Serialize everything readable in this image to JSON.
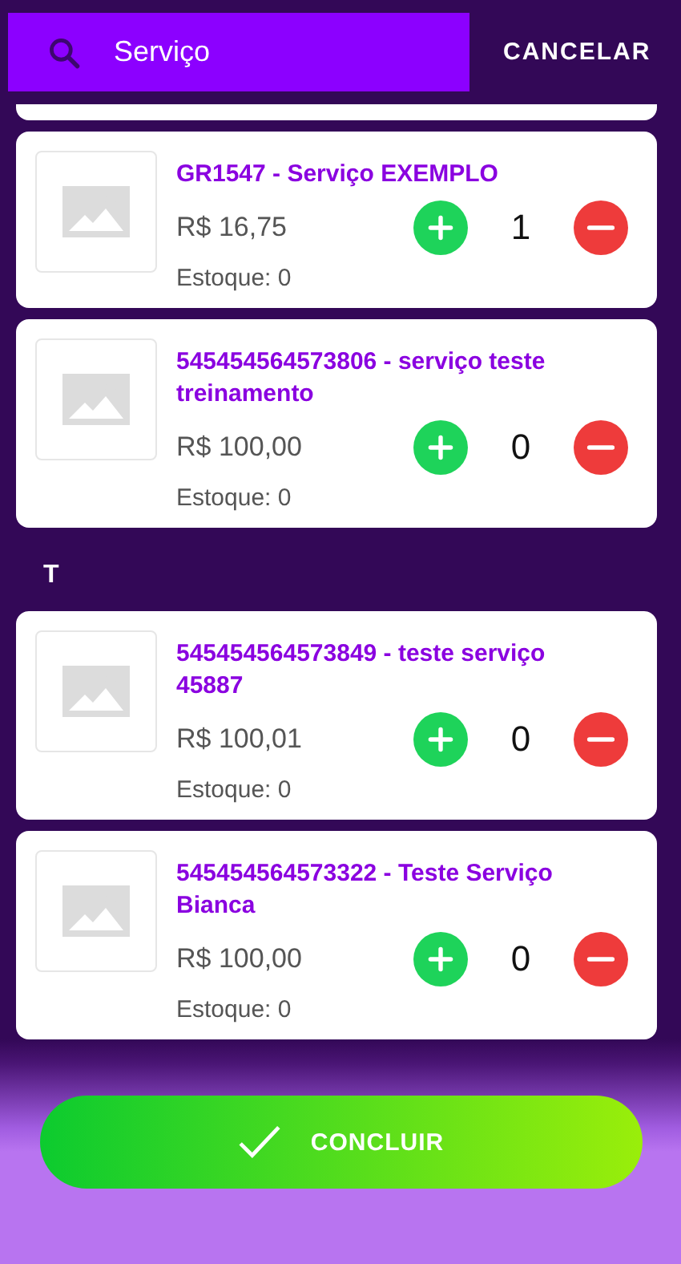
{
  "search": {
    "value": "Serviço"
  },
  "cancel": "CANCELAR",
  "list": [
    {
      "kind": "card",
      "title": "GR1547 - Serviço EXEMPLO",
      "price": "R$ 16,75",
      "quantity": "1",
      "stock": "Estoque: 0"
    },
    {
      "kind": "card",
      "title": "545454564573806 - serviço teste treinamento",
      "price": "R$ 100,00",
      "quantity": "0",
      "stock": "Estoque: 0"
    },
    {
      "kind": "section",
      "label": "T"
    },
    {
      "kind": "card",
      "title": "545454564573849 - teste serviço 45887",
      "price": "R$ 100,01",
      "quantity": "0",
      "stock": "Estoque: 0"
    },
    {
      "kind": "card",
      "title": "545454564573322 - Teste Serviço Bianca",
      "price": "R$ 100,00",
      "quantity": "0",
      "stock": "Estoque: 0"
    }
  ],
  "button": {
    "label": "CONCLUIR"
  }
}
